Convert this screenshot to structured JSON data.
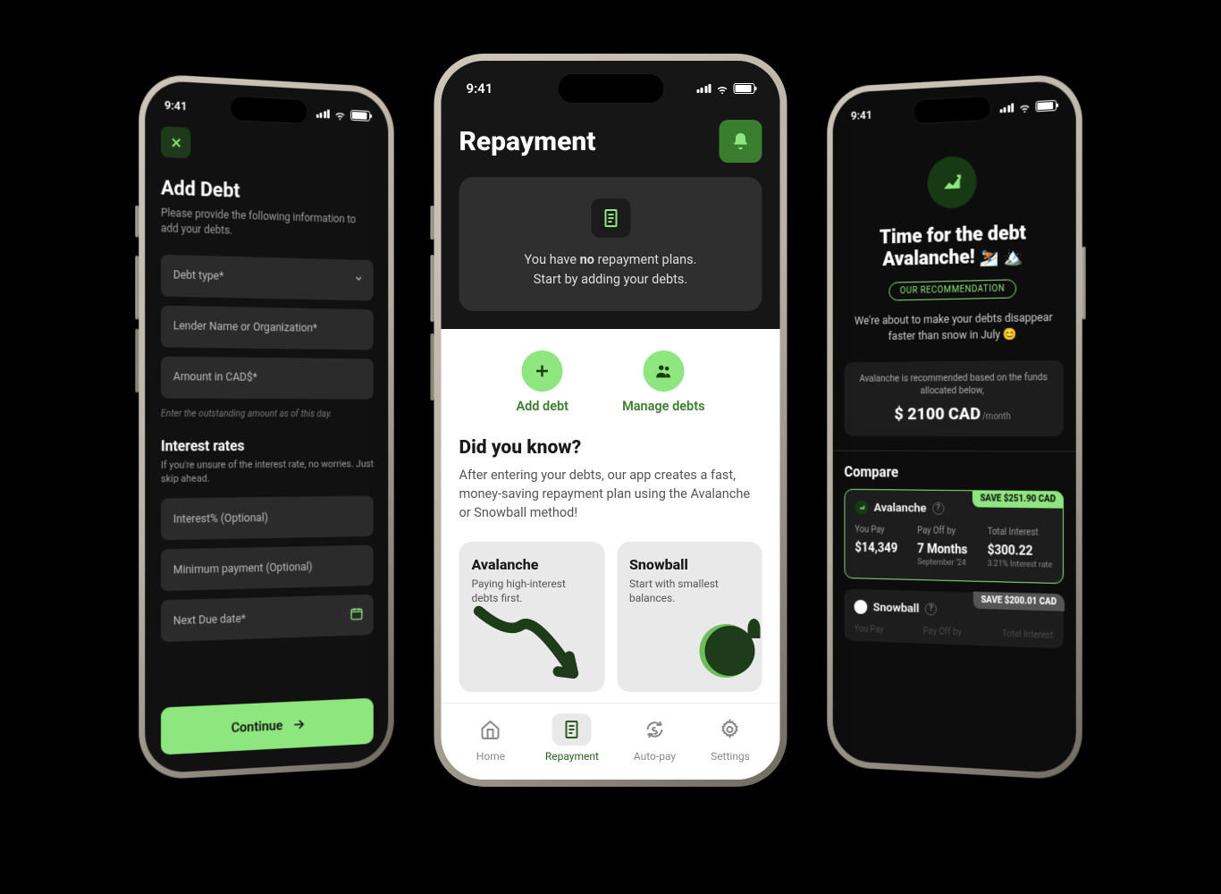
{
  "status_time": "9:41",
  "left": {
    "title": "Add Debt",
    "subtitle": "Please provide the following information to add your debts.",
    "fields": {
      "debt_type": "Debt type*",
      "lender": "Lender Name or Organization*",
      "amount": "Amount in CAD$*",
      "amount_hint": "Enter the outstanding amount as of this day.",
      "interest_title": "Interest rates",
      "interest_sub": "If you're unsure of the interest rate, no worries. Just skip ahead.",
      "interest_pct": "Interest% (Optional)",
      "min_pay": "Minimum payment (Optional)",
      "next_due": "Next Due date*"
    },
    "continue": "Continue"
  },
  "center": {
    "title": "Repayment",
    "empty_line1_a": "You have ",
    "empty_line1_b": "no",
    "empty_line1_c": " repayment plans.",
    "empty_line2": "Start by adding your debts.",
    "add_debt": "Add debt",
    "manage_debts": "Manage debts",
    "dyk_title": "Did you know?",
    "dyk_body": "After entering your debts, our app creates a fast, money-saving repayment plan using the Avalanche or Snowball method!",
    "avalanche": {
      "title": "Avalanche",
      "body": "Paying high-interest debts first."
    },
    "snowball": {
      "title": "Snowball",
      "body": "Start with smallest balances."
    },
    "tabs": {
      "home": "Home",
      "repayment": "Repayment",
      "autopay": "Auto-pay",
      "settings": "Settings"
    }
  },
  "right": {
    "title_l1": "Time for the debt",
    "title_l2": "Avalanche!",
    "badge": "OUR RECOMMENDATION",
    "blurb": "We're about to make your debts disappear faster than snow in July",
    "funds_note": "Avalanche is recommended based on the funds allocated below,",
    "funds_amount": "$ 2100 CAD",
    "funds_suffix": "/month",
    "compare": "Compare",
    "plans": {
      "avalanche": {
        "name": "Avalanche",
        "save": "SAVE $251.90 CAD",
        "you_pay_l": "You Pay",
        "you_pay_v": "$14,349",
        "payoff_l": "Pay Off by",
        "payoff_v": "7 Months",
        "payoff_s": "September '24",
        "interest_l": "Total Interest",
        "interest_v": "$300.22",
        "interest_s": "3.21% Interest rate"
      },
      "snowball": {
        "name": "Snowball",
        "save": "SAVE $200.01 CAD",
        "you_pay_l": "You Pay",
        "payoff_l": "Pay Off by",
        "interest_l": "Total Interest"
      }
    }
  }
}
